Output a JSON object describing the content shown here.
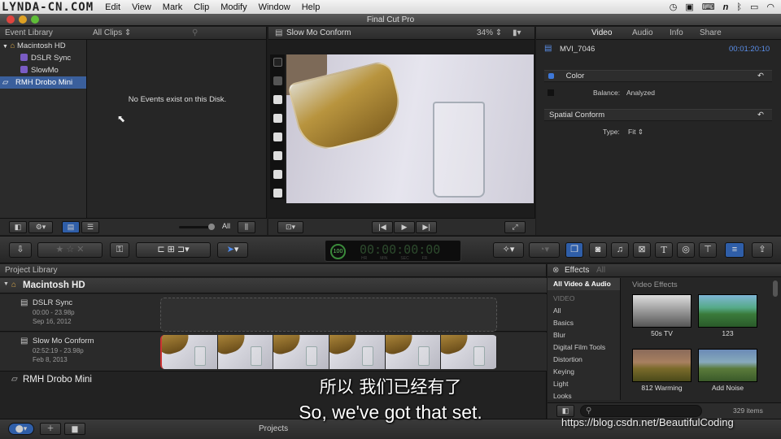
{
  "menubar": {
    "watermark": "LYNDA-CN.COM",
    "items": [
      "Edit",
      "View",
      "Mark",
      "Clip",
      "Modify",
      "Window",
      "Help"
    ]
  },
  "window": {
    "title": "Final Cut Pro"
  },
  "event_library": {
    "header": "Event Library",
    "filter": "All Clips",
    "disk": "Macintosh HD",
    "events": [
      "DSLR Sync",
      "SlowMo"
    ],
    "drive": "RMH Drobo Mini",
    "empty_message": "No Events exist on this Disk.",
    "bottom_all": "All"
  },
  "viewer": {
    "title": "Slow Mo Conform",
    "zoom": "34%"
  },
  "inspector": {
    "tabs": [
      "Video",
      "Audio",
      "Info",
      "Share"
    ],
    "clip_name": "MVI_7046",
    "timecode": "00:01:20:10",
    "color_label": "Color",
    "balance_label": "Balance:",
    "balance_value": "Analyzed",
    "spatial_label": "Spatial Conform",
    "type_label": "Type:",
    "type_value": "Fit"
  },
  "toolbar": {
    "timecode": "00:00:00:00",
    "tc_badge": "100",
    "tc_units": [
      "HR",
      "MIN",
      "SEC",
      "FR"
    ]
  },
  "project_library": {
    "header": "Project Library",
    "disk": "Macintosh HD",
    "projects": [
      {
        "name": "DSLR Sync",
        "info": "00:00 - 23.98p",
        "date": "Sep 16, 2012"
      },
      {
        "name": "Slow Mo Conform",
        "info": "02:52:19 - 23.98p",
        "date": "Feb 8, 2013"
      }
    ],
    "drive": "RMH Drobo Mini"
  },
  "effects": {
    "header": "Effects",
    "filter": "All",
    "selected": "All Video & Audio",
    "section": "VIDEO",
    "categories": [
      "All",
      "Basics",
      "Blur",
      "Digital Film Tools",
      "Distortion",
      "Keying",
      "Light",
      "Looks"
    ],
    "grid_title": "Video Effects",
    "items": [
      "50s TV",
      "123",
      "812 Warming",
      "Add Noise"
    ],
    "count": "329 items"
  },
  "status": {
    "center": "Projects"
  },
  "subtitle": {
    "zh": "所以 我们已经有了",
    "en": "So, we've got that set."
  },
  "url_watermark": "https://blog.csdn.net/BeautifulCoding"
}
